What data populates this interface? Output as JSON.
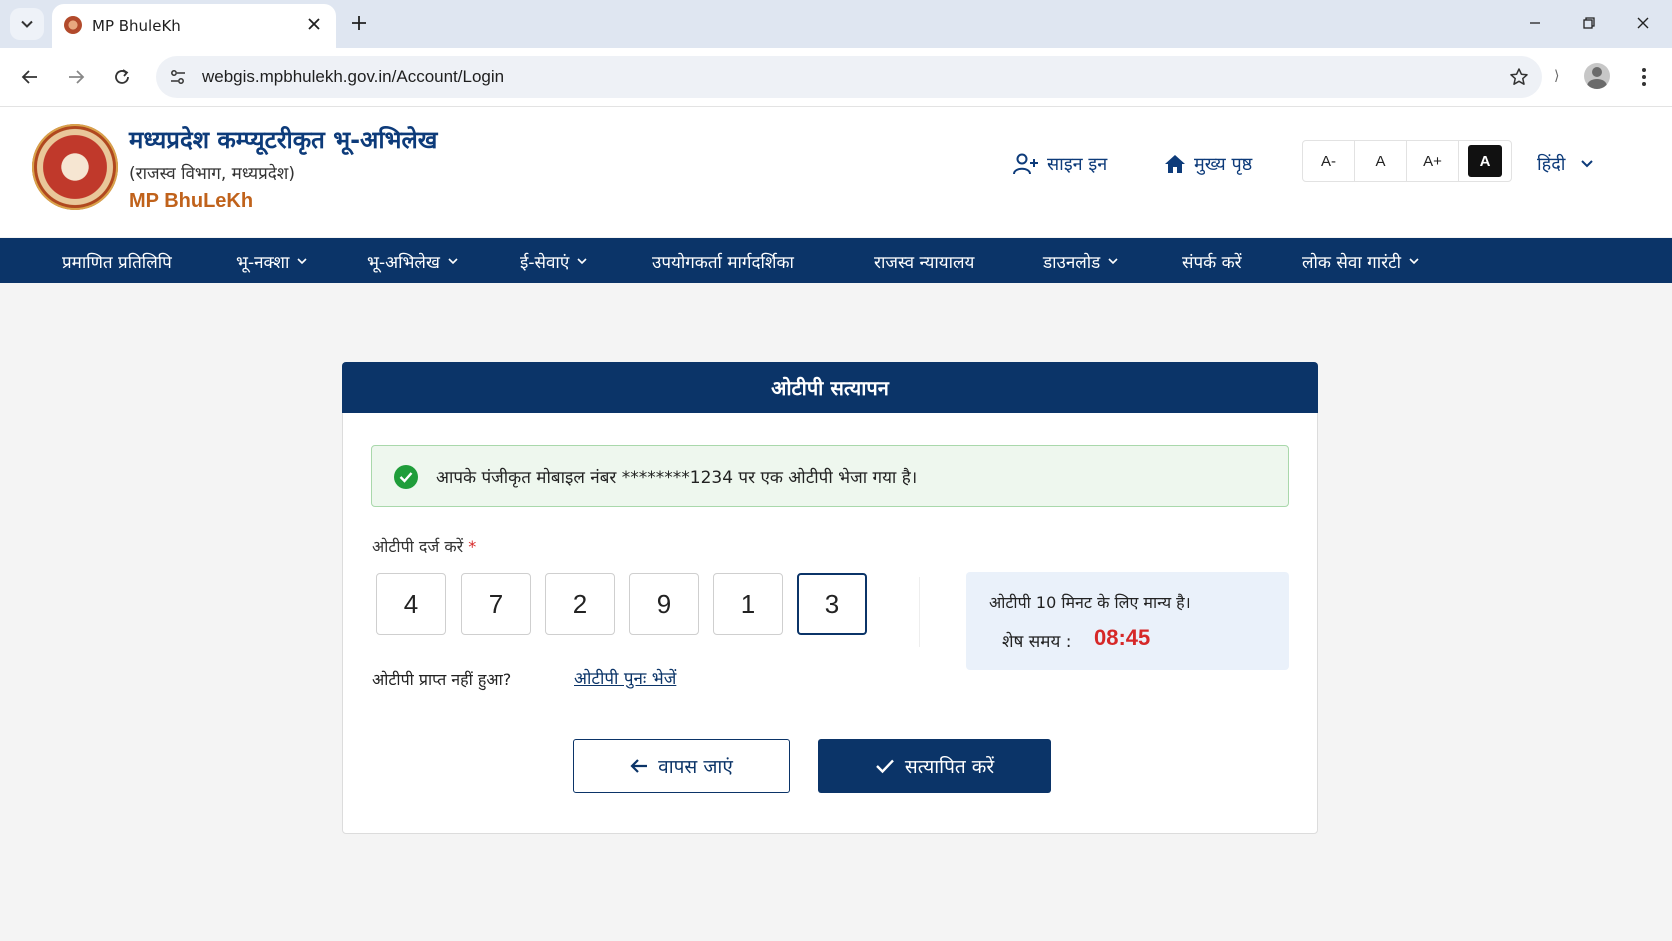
{
  "browser": {
    "tab_title": "MP BhuleKh",
    "url": "webgis.mpbhulekh.gov.in/Account/Login"
  },
  "header": {
    "title": "मध्यप्रदेश कम्प्यूटरीकृत भू-अभिलेख",
    "subtitle": "(राजस्व विभाग, मध्यप्रदेश)",
    "brand": "MP BhuLeKh",
    "signin_label": "साइन इन",
    "home_label": "मुख्य पृष्ठ",
    "font_decrease": "A-",
    "font_normal": "A",
    "font_increase": "A+",
    "font_contrast": "A",
    "language": "हिंदी"
  },
  "nav": {
    "items": [
      {
        "label": "प्रमाणित प्रतिलिपि"
      },
      {
        "label": "भू-नक्शा"
      },
      {
        "label": "भू-अभिलेख"
      },
      {
        "label": "ई-सेवाएं"
      },
      {
        "label": "उपयोगकर्ता मार्गदर्शिका"
      },
      {
        "label": "राजस्व न्यायालय"
      },
      {
        "label": "डाउनलोड"
      },
      {
        "label": "संपर्क करें"
      },
      {
        "label": "लोक सेवा गारंटी"
      }
    ]
  },
  "card": {
    "title": "ओटीपी सत्यापन",
    "alert": "आपके पंजीकृत मोबाइल नंबर ********1234 पर एक ओटीपी भेजा गया है।",
    "otp_label": "ओटीपी दर्ज करें",
    "required_mark": "*",
    "otp_digits": [
      "4",
      "7",
      "2",
      "9",
      "1",
      "3"
    ],
    "validity_text": "ओटीपी 10 मिनट के लिए मान्य है।",
    "remaining_label": "शेष समय :",
    "remaining_value": "08:45",
    "not_received": "ओटीपी प्राप्त नहीं हुआ?",
    "resend_label": "ओटीपी पुनः भेजें",
    "back_label": "वापस जाएं",
    "verify_label": "सत्यापित करें"
  },
  "colors": {
    "primary": "#0b3468",
    "success": "#1f9d3a",
    "danger": "#d62828",
    "brand_orange": "#c0621b"
  }
}
